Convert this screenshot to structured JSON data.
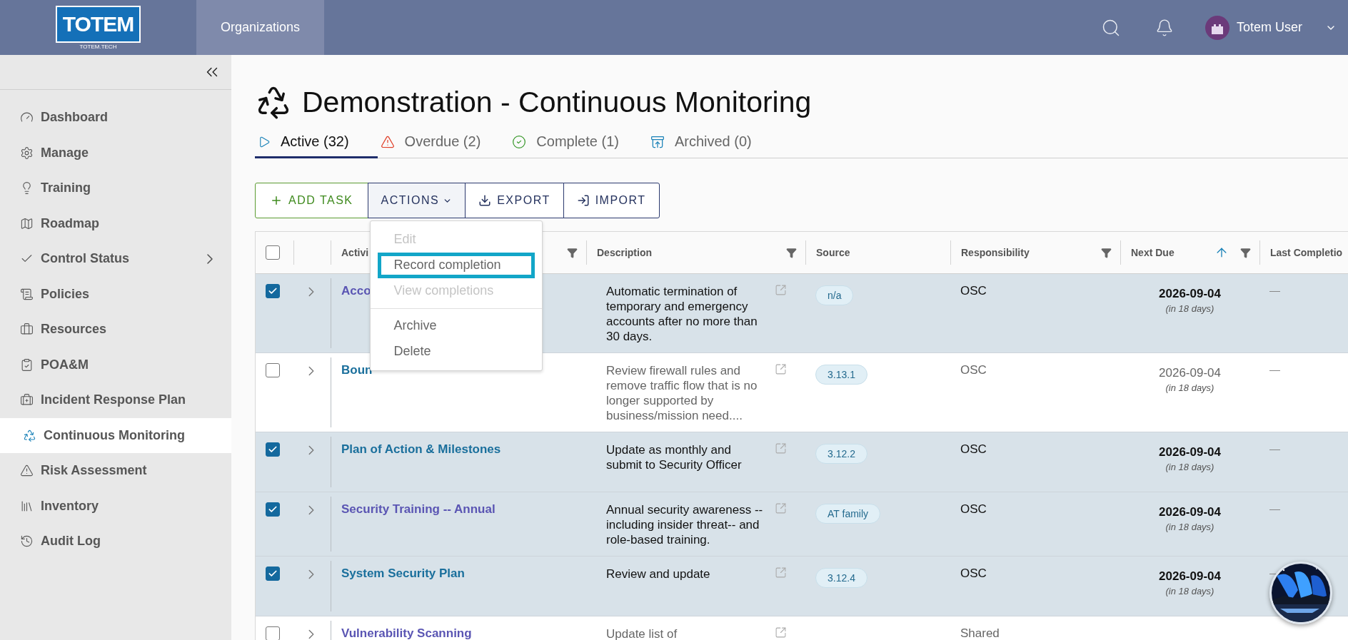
{
  "header": {
    "logo": {
      "name": "TOTEM",
      "tagline": "TOTEM.TECH"
    },
    "nav": [
      {
        "label": "Organizations",
        "selected": true
      }
    ],
    "user": {
      "name": "Totem User"
    }
  },
  "sidebar": {
    "items": [
      {
        "label": "Dashboard",
        "selected": false,
        "has_submenu": false
      },
      {
        "label": "Manage",
        "selected": false,
        "has_submenu": false
      },
      {
        "label": "Training",
        "selected": false,
        "has_submenu": false
      },
      {
        "label": "Roadmap",
        "selected": false,
        "has_submenu": false
      },
      {
        "label": "Control Status",
        "selected": false,
        "has_submenu": true
      },
      {
        "label": "Policies",
        "selected": false,
        "has_submenu": false
      },
      {
        "label": "Resources",
        "selected": false,
        "has_submenu": false
      },
      {
        "label": "POA&M",
        "selected": false,
        "has_submenu": false
      },
      {
        "label": "Incident Response Plan",
        "selected": false,
        "has_submenu": false
      },
      {
        "label": "Continuous Monitoring",
        "selected": true,
        "has_submenu": false
      },
      {
        "label": "Risk Assessment",
        "selected": false,
        "has_submenu": false
      },
      {
        "label": "Inventory",
        "selected": false,
        "has_submenu": false
      },
      {
        "label": "Audit Log",
        "selected": false,
        "has_submenu": false
      }
    ]
  },
  "page": {
    "title": "Demonstration - Continuous Monitoring",
    "tabs": [
      {
        "label": "Active (32)",
        "kind": "active",
        "selected": true
      },
      {
        "label": "Overdue (2)",
        "kind": "overdue",
        "selected": false
      },
      {
        "label": "Complete (1)",
        "kind": "complete",
        "selected": false
      },
      {
        "label": "Archived (0)",
        "kind": "archived",
        "selected": false
      }
    ],
    "toolbar": [
      {
        "label": "ADD TASK",
        "kind": "add"
      },
      {
        "label": "ACTIONS",
        "kind": "menu",
        "expanded": true
      },
      {
        "label": "EXPORT",
        "kind": "export"
      },
      {
        "label": "IMPORT",
        "kind": "import"
      }
    ],
    "actions_menu": [
      {
        "label": "Edit",
        "disabled": true,
        "highlighted": false
      },
      {
        "label": "Record completion",
        "disabled": false,
        "highlighted": true
      },
      {
        "label": "View completions",
        "disabled": true,
        "highlighted": false
      },
      {
        "label": "Archive",
        "disabled": false,
        "highlighted": false,
        "divider_before": true
      },
      {
        "label": "Delete",
        "disabled": false,
        "highlighted": false
      }
    ]
  },
  "table": {
    "header_checkbox": {
      "checked": false
    },
    "columns": [
      {
        "label": "Activi",
        "filter": true
      },
      {
        "label": "Description",
        "filter": true
      },
      {
        "label": "Source"
      },
      {
        "label": "Responsibility",
        "filter": true
      },
      {
        "label": "Next Due",
        "filter": true,
        "sorted_ascending": true
      },
      {
        "label": "Last Completio"
      }
    ],
    "rows": [
      {
        "checked": true,
        "activity": "Acco",
        "visited": true,
        "description": "Automatic termination of temporary and emergency accounts after no more than 30 days.",
        "source": "n/a",
        "responsibility": "OSC",
        "next_due": "2026-09-04",
        "due_in": "(in 18 days)",
        "last_completion": "—"
      },
      {
        "checked": false,
        "activity": "Boun",
        "visited": false,
        "description": "Review firewall rules and remove traffic flow that is no longer supported by business/mission need....",
        "source": "3.13.1",
        "responsibility": "OSC",
        "next_due": "2026-09-04",
        "due_in": "(in 18 days)",
        "last_completion": "—"
      },
      {
        "checked": true,
        "activity": "Plan of Action & Milestones",
        "visited": false,
        "description": "Update as monthly and submit to Security Officer",
        "source": "3.12.2",
        "responsibility": "OSC",
        "next_due": "2026-09-04",
        "due_in": "(in 18 days)",
        "last_completion": "—"
      },
      {
        "checked": true,
        "activity": "Security Training -- Annual",
        "visited": true,
        "description": "Annual security awareness --including insider threat-- and role-based training.",
        "source": "AT family",
        "responsibility": "OSC",
        "next_due": "2026-09-04",
        "due_in": "(in 18 days)",
        "last_completion": "—"
      },
      {
        "checked": true,
        "activity": "System Security Plan",
        "visited": false,
        "description": "Review and update",
        "source": "3.12.4",
        "responsibility": "OSC",
        "next_due": "2026-09-04",
        "due_in": "(in 18 days)",
        "last_completion": "—"
      },
      {
        "checked": false,
        "activity": "Vulnerability Scanning",
        "visited": true,
        "description": "Update list of",
        "responsibility": "Shared"
      }
    ]
  }
}
